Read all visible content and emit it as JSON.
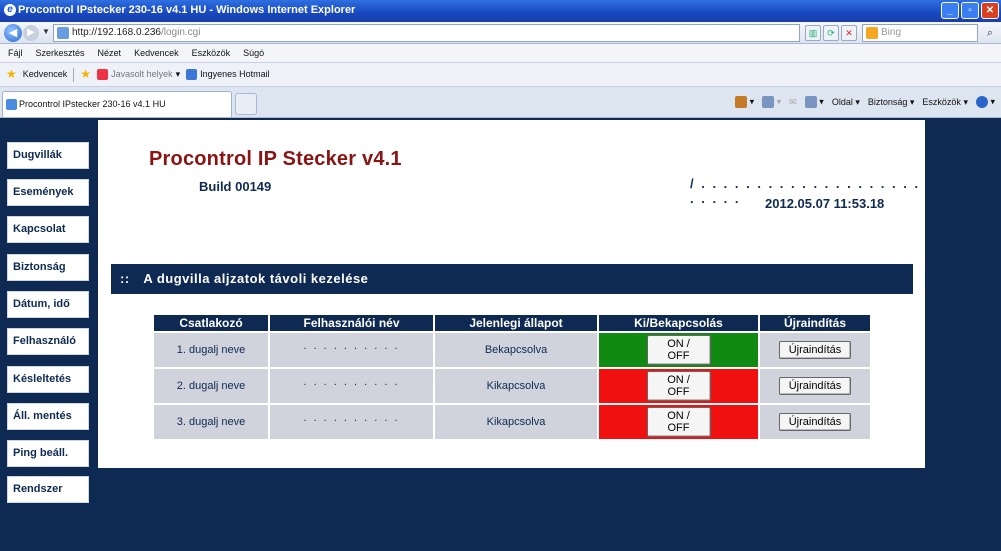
{
  "window": {
    "title": "Procontrol IPstecker 230-16 v4.1 HU - Windows Internet Explorer"
  },
  "address": {
    "url_host": "http://192.168.0.236",
    "url_path": "/login.cgi",
    "search_placeholder": "Bing"
  },
  "menu": [
    "Fájl",
    "Szerkesztés",
    "Nézet",
    "Kedvencek",
    "Eszközök",
    "Súgó"
  ],
  "favorites": {
    "label": "Kedvencek",
    "suggested": "Javasolt helyek",
    "hotmail": "Ingyenes Hotmail"
  },
  "tab": {
    "title": "Procontrol IPstecker 230-16 v4.1 HU"
  },
  "command_bar": {
    "page": "Oldal",
    "safety": "Biztonság",
    "tools": "Eszközök"
  },
  "sidebar": {
    "items": [
      {
        "label": "Dugvillák"
      },
      {
        "label": "Események"
      },
      {
        "label": "Kapcsolat"
      },
      {
        "label": "Biztonság"
      },
      {
        "label": "Dátum, idő"
      },
      {
        "label": "Felhasználó"
      },
      {
        "label": "Késleltetés"
      },
      {
        "label": "Áll. mentés"
      },
      {
        "label": "Ping beáll."
      },
      {
        "label": "Rendszer"
      }
    ]
  },
  "header": {
    "title": "Procontrol IP Stecker v4.1",
    "build": "Build 00149",
    "dots": "/ . . . . . . . . . . . . . . . . . . . . . . . . .",
    "datetime": "2012.05.07 11:53.18"
  },
  "section": {
    "colons": "::",
    "title": "A dugvilla aljzatok távoli kezelése"
  },
  "table": {
    "headers": [
      "Csatlakozó",
      "Felhasználói név",
      "Jelenlegi állapot",
      "Ki/Bekapcsolás",
      "Újraindítás"
    ],
    "rows": [
      {
        "name": "1. dugalj neve",
        "user": ". . . . . . . . . .",
        "state": "Bekapcsolva",
        "toggle": "ON / OFF",
        "restart": "Újraindítás",
        "state_color": "#118a11"
      },
      {
        "name": "2. dugalj neve",
        "user": ". . . . . . . . . .",
        "state": "Kikapcsolva",
        "toggle": "ON / OFF",
        "restart": "Újraindítás",
        "state_color": "#f01010"
      },
      {
        "name": "3. dugalj neve",
        "user": ". . . . . . . . . .",
        "state": "Kikapcsolva",
        "toggle": "ON / OFF",
        "restart": "Újraindítás",
        "state_color": "#f01010"
      }
    ]
  },
  "colors": {
    "navy": "#0e2a52",
    "title_red": "#8a1414",
    "on": "#118a11",
    "off": "#f01010"
  }
}
